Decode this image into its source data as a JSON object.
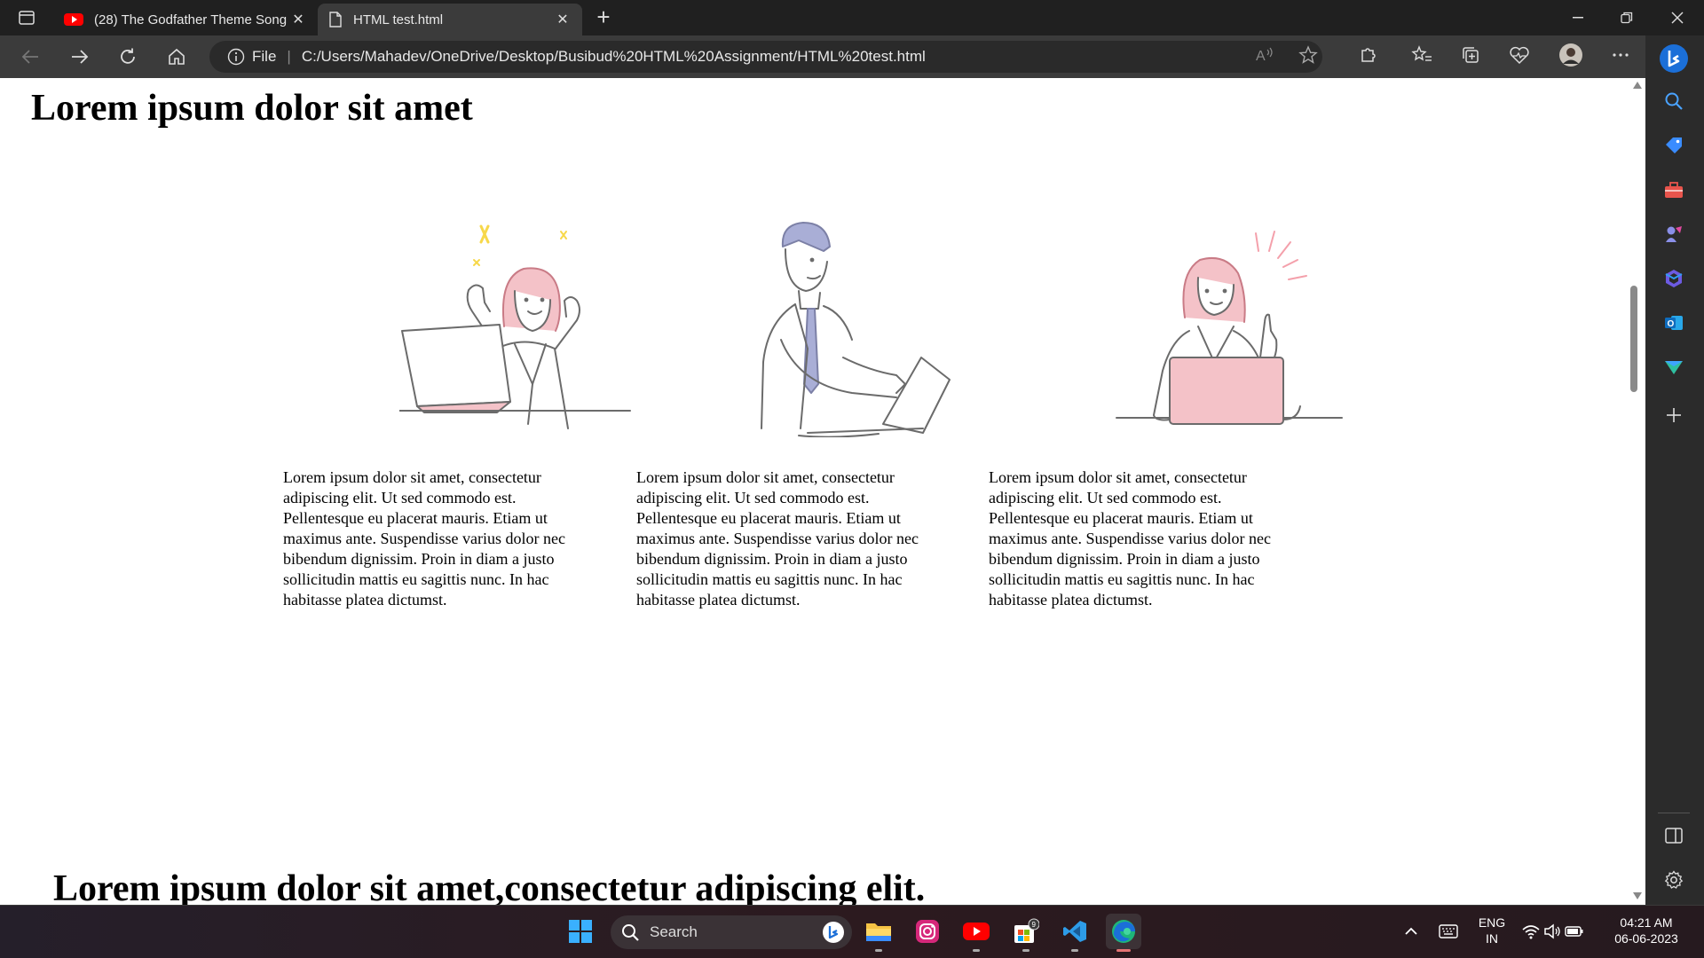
{
  "browser": {
    "tabs": [
      {
        "title": "(28) The Godfather Theme Song",
        "icon": "youtube-icon",
        "active": false
      },
      {
        "title": "HTML test.html",
        "icon": "file-icon",
        "active": true
      }
    ],
    "address": {
      "scheme_label": "File",
      "url": "C:/Users/Mahadev/OneDrive/Desktop/Busibud%20HTML%20Assignment/HTML%20test.html"
    }
  },
  "page": {
    "heading": "Lorem ipsum dolor sit amet",
    "cards": [
      {
        "illustration": "woman-celebrating-at-laptop",
        "text": "Lorem ipsum dolor sit amet, consectetur adipiscing elit. Ut sed commodo est. Pellentesque eu placerat mauris. Etiam ut maximus ante. Suspendisse varius dolor nec bibendum dignissim. Proin in diam a justo sollicitudin mattis eu sagittis nunc. In hac habitasse platea dictumst."
      },
      {
        "illustration": "man-typing-on-laptop",
        "text": "Lorem ipsum dolor sit amet, consectetur adipiscing elit. Ut sed commodo est. Pellentesque eu placerat mauris. Etiam ut maximus ante. Suspendisse varius dolor nec bibendum dignissim. Proin in diam a justo sollicitudin mattis eu sagittis nunc. In hac habitasse platea dictumst."
      },
      {
        "illustration": "woman-with-idea-at-laptop",
        "text": "Lorem ipsum dolor sit amet, consectetur adipiscing elit. Ut sed commodo est. Pellentesque eu placerat mauris. Etiam ut maximus ante. Suspendisse varius dolor nec bibendum dignissim. Proin in diam a justo sollicitudin mattis eu sagittis nunc. In hac habitasse platea dictumst."
      }
    ],
    "heading2": "Lorem ipsum dolor sit amet,consectetur adipiscing elit."
  },
  "taskbar": {
    "search_label": "Search",
    "language": "ENG",
    "region": "IN",
    "time": "04:21 AM",
    "date": "06-06-2023"
  },
  "colors": {
    "accent_pink": "#f4c2c8",
    "line_gray": "#6b6b6b",
    "tie_blue": "#a9aed6",
    "star_yellow": "#f7d84a"
  }
}
